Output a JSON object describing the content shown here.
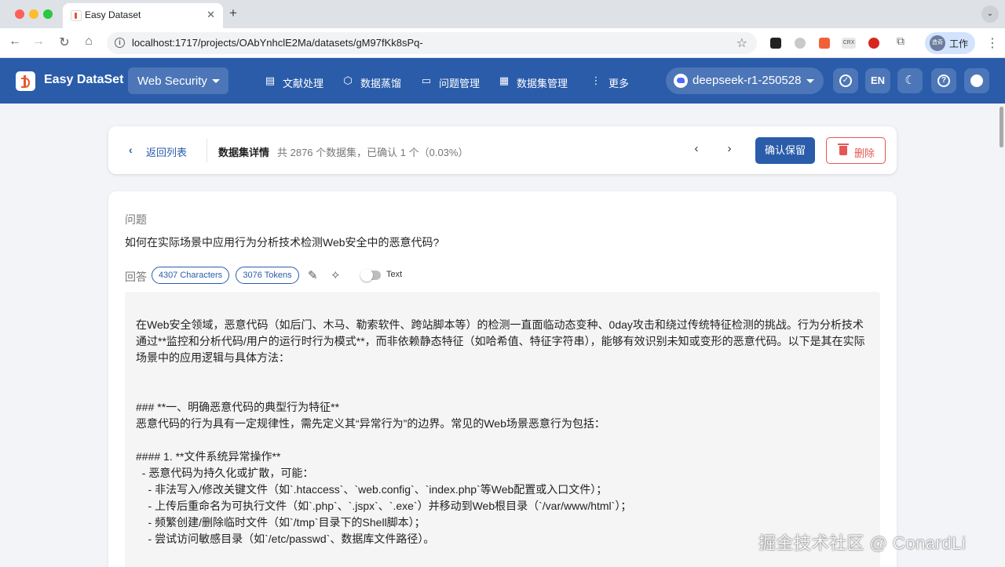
{
  "browser": {
    "tab_title": "Easy Dataset",
    "tab_close": "✕",
    "new_tab": "+",
    "url": "localhost:1717/projects/OAbYnhclE2Ma/datasets/gM97fKk8sPq-",
    "profile_label": "工作",
    "profile_avatar": "造奇",
    "ext_crx": "CRX"
  },
  "app": {
    "name": "Easy DataSet",
    "project": "Web Security",
    "nav": [
      {
        "label": "文献处理",
        "icon": "document-icon"
      },
      {
        "label": "数据蒸馏",
        "icon": "cube-icon"
      },
      {
        "label": "问题管理",
        "icon": "question-chat-icon"
      },
      {
        "label": "数据集管理",
        "icon": "dataset-grid-icon"
      },
      {
        "label": "更多",
        "icon": "more-vertical-icon"
      }
    ],
    "model": "deepseek-r1-250528",
    "lang": "EN",
    "accent": "#2a5caa"
  },
  "toolbar": {
    "back_label": "返回列表",
    "title": "数据集详情",
    "count_text": "共 2876 个数据集，已确认 1 个（0.03%）",
    "confirm_label": "确认保留",
    "delete_label": "删除"
  },
  "question": {
    "label": "问题",
    "text": "如何在实际场景中应用行为分析技术检测Web安全中的恶意代码?"
  },
  "answer": {
    "label": "回答",
    "characters": "4307 Characters",
    "tokens": "3076 Tokens",
    "toggle_label": "Text",
    "lines": [
      "在Web安全领域，恶意代码（如后门、木马、勒索软件、跨站脚本等）的检测一直面临动态变种、0day攻击和绕过传统特征检测的挑战。行为分析技术通过**监控和分析代码/用户的运行时行为模式**，而非依赖静态特征（如哈希值、特征字符串），能够有效识别未知或变形的恶意代码。以下是其在实际场景中的应用逻辑与具体方法：",
      "",
      "",
      "### **一、明确恶意代码的典型行为特征**",
      "恶意代码的行为具有一定规律性，需先定义其“异常行为”的边界。常见的Web场景恶意行为包括：",
      "",
      "#### 1. **文件系统异常操作**",
      "  - 恶意代码为持久化或扩散，可能：",
      "    - 非法写入/修改关键文件（如`.htaccess`、`web.config`、`index.php`等Web配置或入口文件）；",
      "    - 上传后重命名为可执行文件（如`.php`、`.jspx`、`.exe`）并移动到Web根目录（`/var/www/html`）；",
      "    - 频繁创建/删除临时文件（如`/tmp`目录下的Shell脚本）；",
      "    - 尝试访问敏感目录（如`/etc/passwd`、数据库文件路径）。"
    ]
  },
  "watermark": "掘金技术社区 @ ConardLi"
}
